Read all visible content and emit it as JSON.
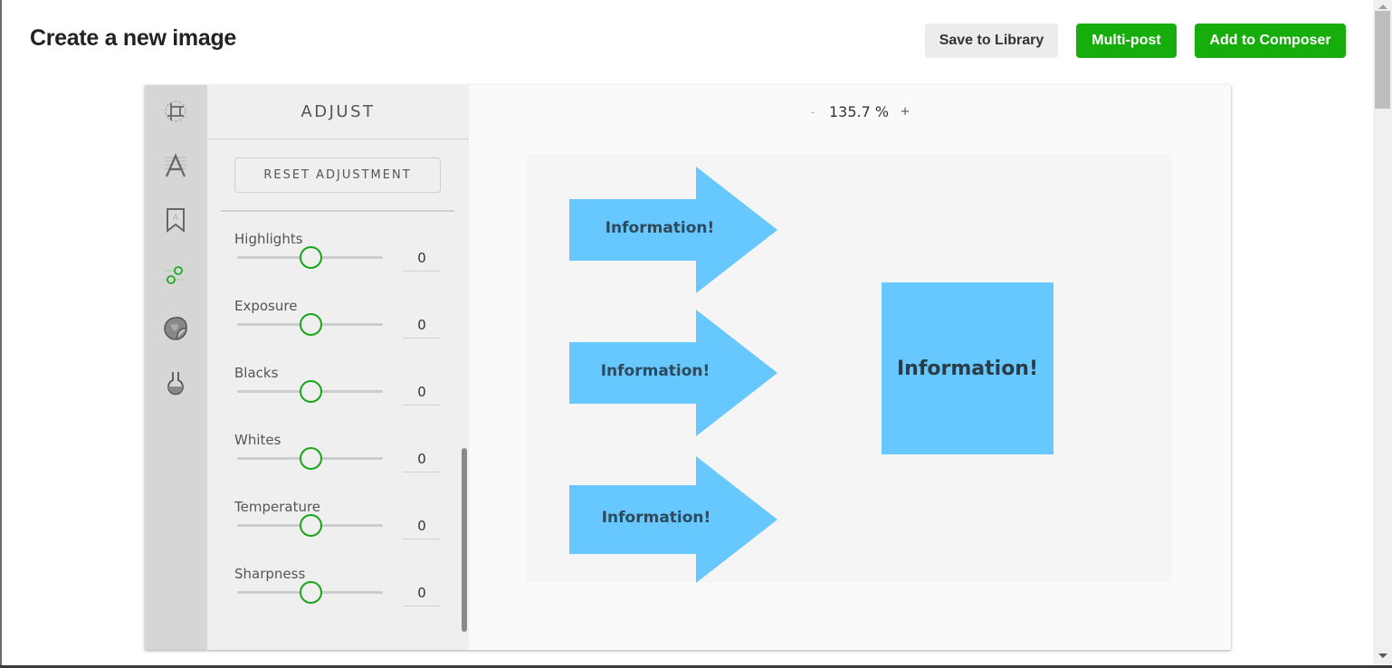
{
  "header": {
    "title": "Create a new image",
    "buttons": {
      "save_to_library": "Save to Library",
      "multi_post": "Multi-post",
      "add_to_composer": "Add to Composer"
    }
  },
  "colors": {
    "primary_green": "#17ad0d",
    "slider_green": "#1aa51a",
    "shape_blue": "#66c8ff"
  },
  "toolbar": {
    "tools": [
      {
        "name": "crop",
        "icon": "crop-icon"
      },
      {
        "name": "text",
        "icon": "text-icon"
      },
      {
        "name": "stickers",
        "icon": "bookmark-icon"
      },
      {
        "name": "adjust",
        "icon": "adjust-sliders-icon",
        "active": true
      },
      {
        "name": "overlay",
        "icon": "sticker-heart-icon"
      },
      {
        "name": "filters",
        "icon": "flask-icon"
      }
    ]
  },
  "panel": {
    "title": "ADJUST",
    "reset_label": "RESET ADJUSTMENT",
    "sliders": [
      {
        "label": "Highlights",
        "value": "0",
        "position": 0.5
      },
      {
        "label": "Exposure",
        "value": "0",
        "position": 0.5
      },
      {
        "label": "Blacks",
        "value": "0",
        "position": 0.5
      },
      {
        "label": "Whites",
        "value": "0",
        "position": 0.5
      },
      {
        "label": "Temperature",
        "value": "0",
        "position": 0.5
      },
      {
        "label": "Sharpness",
        "value": "0",
        "position": 0.5
      }
    ]
  },
  "canvas": {
    "zoom_minus": "-",
    "zoom_value": "135.7 %",
    "zoom_plus": "+",
    "arrows": [
      {
        "text": "Information!"
      },
      {
        "text": "Information!"
      },
      {
        "text": "Information!"
      }
    ],
    "box_text": "Information!"
  }
}
